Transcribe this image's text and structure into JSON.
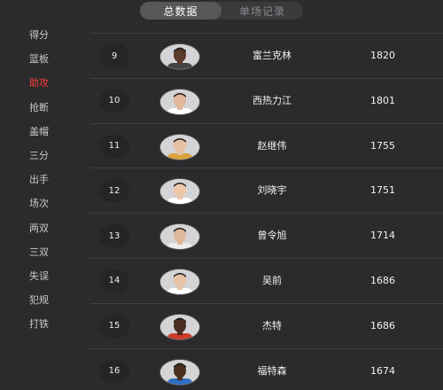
{
  "tabs": [
    {
      "label": "总数据",
      "active": true
    },
    {
      "label": "单场记录",
      "active": false
    }
  ],
  "sidebar": {
    "items": [
      {
        "label": "得分",
        "active": false
      },
      {
        "label": "篮板",
        "active": false
      },
      {
        "label": "助攻",
        "active": true
      },
      {
        "label": "抢断",
        "active": false
      },
      {
        "label": "盖帽",
        "active": false
      },
      {
        "label": "三分",
        "active": false
      },
      {
        "label": "出手",
        "active": false
      },
      {
        "label": "场次",
        "active": false
      },
      {
        "label": "两双",
        "active": false
      },
      {
        "label": "三双",
        "active": false
      },
      {
        "label": "失误",
        "active": false
      },
      {
        "label": "犯规",
        "active": false
      },
      {
        "label": "打铁",
        "active": false
      }
    ]
  },
  "colors": {
    "background": "#2b2b2d",
    "accent": "#ff3b3b",
    "tab_active": "#575759"
  },
  "rows": [
    {
      "rank": "9",
      "name": "富兰克林",
      "value": "1820",
      "skin": "#5a3b2c",
      "jersey": "#444444"
    },
    {
      "rank": "10",
      "name": "西热力江",
      "value": "1801",
      "skin": "#e2b89a",
      "jersey": "#ffffff"
    },
    {
      "rank": "11",
      "name": "赵继伟",
      "value": "1755",
      "skin": "#e6c0a2",
      "jersey": "#d8a23a"
    },
    {
      "rank": "12",
      "name": "刘晓宇",
      "value": "1751",
      "skin": "#ecc7aa",
      "jersey": "#ffffff"
    },
    {
      "rank": "13",
      "name": "曾令旭",
      "value": "1714",
      "skin": "#dfb89a",
      "jersey": "#eeeeee"
    },
    {
      "rank": "14",
      "name": "吴前",
      "value": "1686",
      "skin": "#e8c3a6",
      "jersey": "#ffffff"
    },
    {
      "rank": "15",
      "name": "杰特",
      "value": "1686",
      "skin": "#4a2e22",
      "jersey": "#cc3b2c"
    },
    {
      "rank": "16",
      "name": "福特森",
      "value": "1674",
      "skin": "#4b3022",
      "jersey": "#2f6fc0"
    }
  ]
}
